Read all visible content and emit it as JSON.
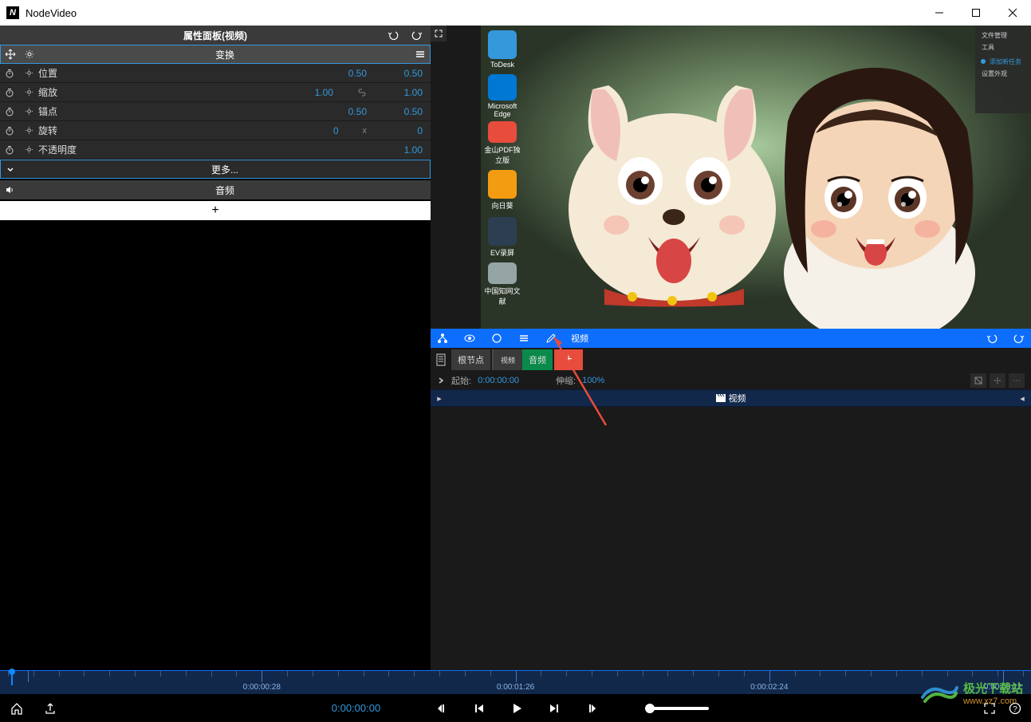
{
  "app": {
    "title": "NodeVideo"
  },
  "window_controls": {
    "min": "minimize",
    "max": "maximize",
    "close": "close"
  },
  "properties_panel": {
    "title": "属性面板(视频)",
    "transform_section": "变换",
    "rows": {
      "position": {
        "label": "位置",
        "v1": "0.50",
        "v2": "0.50"
      },
      "scale": {
        "label": "缩放",
        "v1": "1.00",
        "v2": "1.00"
      },
      "anchor": {
        "label": "锚点",
        "v1": "0.50",
        "v2": "0.50"
      },
      "rotation": {
        "label": "旋转",
        "v1": "0",
        "sep": "x",
        "v2": "0"
      },
      "opacity": {
        "label": "不透明度",
        "v1": "1.00"
      }
    },
    "more": "更多...",
    "audio_section": "音频",
    "add": "+"
  },
  "preview": {
    "desktop_icons": [
      {
        "label": "ToDesk",
        "color": "#3498db"
      },
      {
        "label": "Microsoft Edge",
        "color": "#0078d4"
      },
      {
        "label": "金山PDF独立版",
        "color": "#e74c3c"
      },
      {
        "label": "向日葵",
        "color": "#f39c12"
      },
      {
        "label": "EV录屏",
        "color": "#2c3e50"
      },
      {
        "label": "中国知网文献",
        "color": "#95a5a6"
      }
    ],
    "side_menu": [
      "文件管理",
      "工具",
      "添加新任务",
      "设置外观"
    ]
  },
  "toolbar": {
    "video_label": "视频"
  },
  "tabs": {
    "root": "根节点",
    "video": "视频",
    "audio": "音频",
    "add": "+"
  },
  "timeline_info": {
    "start_label": "起始:",
    "start_val": "0:00:00:00",
    "stretch_label": "伸缩:",
    "stretch_val": "100%"
  },
  "track": {
    "label": "视频"
  },
  "ruler": {
    "ticks": [
      {
        "pos": 2,
        "label": ""
      },
      {
        "pos": 25,
        "label": "0:00:00:28"
      },
      {
        "pos": 50,
        "label": "0:00:01:26"
      },
      {
        "pos": 75,
        "label": "0:00:02:24"
      },
      {
        "pos": 98,
        "label": "0:00:03:22"
      }
    ]
  },
  "playback": {
    "time": "0:00:00:00"
  },
  "watermark": {
    "cn": "极光下载站",
    "url": "www.xz7.com"
  }
}
